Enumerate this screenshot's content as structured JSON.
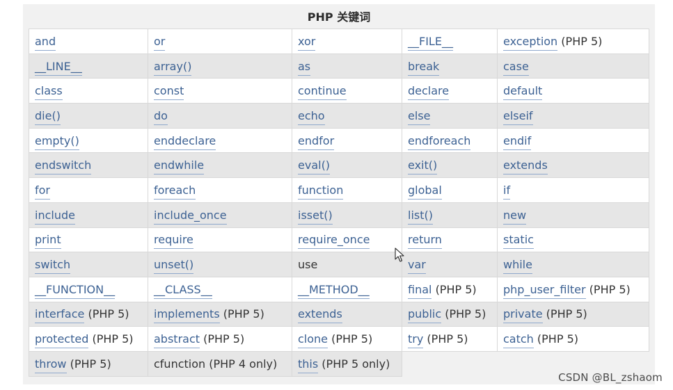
{
  "title": "PHP 关键词",
  "rows": [
    [
      {
        "text": "and",
        "link": true,
        "note": ""
      },
      {
        "text": "or",
        "link": true,
        "note": ""
      },
      {
        "text": "xor",
        "link": true,
        "note": ""
      },
      {
        "text": "__FILE__",
        "link": true,
        "note": ""
      },
      {
        "text": "exception",
        "link": true,
        "note": "(PHP 5)"
      }
    ],
    [
      {
        "text": "__LINE__",
        "link": true,
        "note": ""
      },
      {
        "text": "array()",
        "link": true,
        "note": ""
      },
      {
        "text": "as",
        "link": true,
        "note": ""
      },
      {
        "text": "break",
        "link": true,
        "note": ""
      },
      {
        "text": "case",
        "link": true,
        "note": ""
      }
    ],
    [
      {
        "text": "class",
        "link": true,
        "note": ""
      },
      {
        "text": "const",
        "link": true,
        "note": ""
      },
      {
        "text": "continue",
        "link": true,
        "note": ""
      },
      {
        "text": "declare",
        "link": true,
        "note": ""
      },
      {
        "text": "default",
        "link": true,
        "note": ""
      }
    ],
    [
      {
        "text": "die()",
        "link": true,
        "note": ""
      },
      {
        "text": "do",
        "link": true,
        "note": ""
      },
      {
        "text": "echo",
        "link": true,
        "note": ""
      },
      {
        "text": "else",
        "link": true,
        "note": ""
      },
      {
        "text": "elseif",
        "link": true,
        "note": ""
      }
    ],
    [
      {
        "text": "empty()",
        "link": true,
        "note": ""
      },
      {
        "text": "enddeclare",
        "link": true,
        "note": ""
      },
      {
        "text": "endfor",
        "link": true,
        "note": ""
      },
      {
        "text": "endforeach",
        "link": true,
        "note": ""
      },
      {
        "text": "endif",
        "link": true,
        "note": ""
      }
    ],
    [
      {
        "text": "endswitch",
        "link": true,
        "note": ""
      },
      {
        "text": "endwhile",
        "link": true,
        "note": ""
      },
      {
        "text": "eval()",
        "link": true,
        "note": ""
      },
      {
        "text": "exit()",
        "link": true,
        "note": ""
      },
      {
        "text": "extends",
        "link": true,
        "note": ""
      }
    ],
    [
      {
        "text": "for",
        "link": true,
        "note": ""
      },
      {
        "text": "foreach",
        "link": true,
        "note": ""
      },
      {
        "text": "function",
        "link": true,
        "note": ""
      },
      {
        "text": "global",
        "link": true,
        "note": ""
      },
      {
        "text": "if",
        "link": true,
        "note": ""
      }
    ],
    [
      {
        "text": "include",
        "link": true,
        "note": ""
      },
      {
        "text": "include_once",
        "link": true,
        "note": ""
      },
      {
        "text": "isset()",
        "link": true,
        "note": ""
      },
      {
        "text": "list()",
        "link": true,
        "note": ""
      },
      {
        "text": "new",
        "link": true,
        "note": ""
      }
    ],
    [
      {
        "text": "print",
        "link": true,
        "note": ""
      },
      {
        "text": "require",
        "link": true,
        "note": ""
      },
      {
        "text": "require_once",
        "link": true,
        "note": ""
      },
      {
        "text": "return",
        "link": true,
        "note": ""
      },
      {
        "text": "static",
        "link": true,
        "note": ""
      }
    ],
    [
      {
        "text": "switch",
        "link": true,
        "note": ""
      },
      {
        "text": "unset()",
        "link": true,
        "note": ""
      },
      {
        "text": "use",
        "link": false,
        "note": ""
      },
      {
        "text": "var",
        "link": true,
        "note": ""
      },
      {
        "text": "while",
        "link": true,
        "note": ""
      }
    ],
    [
      {
        "text": "__FUNCTION__",
        "link": true,
        "note": ""
      },
      {
        "text": "__CLASS__",
        "link": true,
        "note": ""
      },
      {
        "text": "__METHOD__",
        "link": true,
        "note": ""
      },
      {
        "text": "final",
        "link": true,
        "note": "(PHP 5)"
      },
      {
        "text": "php_user_filter",
        "link": true,
        "note": "(PHP 5)"
      }
    ],
    [
      {
        "text": "interface",
        "link": true,
        "note": "(PHP 5)"
      },
      {
        "text": "implements",
        "link": true,
        "note": "(PHP 5)"
      },
      {
        "text": "extends",
        "link": true,
        "note": ""
      },
      {
        "text": "public",
        "link": true,
        "note": "(PHP 5)"
      },
      {
        "text": "private",
        "link": true,
        "note": "(PHP 5)"
      }
    ],
    [
      {
        "text": "protected",
        "link": true,
        "note": "(PHP 5)"
      },
      {
        "text": "abstract",
        "link": true,
        "note": "(PHP 5)"
      },
      {
        "text": "clone",
        "link": true,
        "note": "(PHP 5)"
      },
      {
        "text": "try",
        "link": true,
        "note": "(PHP 5)"
      },
      {
        "text": "catch",
        "link": true,
        "note": "(PHP 5)"
      }
    ],
    [
      {
        "text": "throw",
        "link": true,
        "note": "(PHP 5)"
      },
      {
        "text": "cfunction",
        "link": false,
        "note": "(PHP 4 only)"
      },
      {
        "text": "this",
        "link": true,
        "note": "(PHP 5 only)"
      }
    ]
  ],
  "watermark": "CSDN @BL_zshaom",
  "colors": {
    "link": "#3c6193",
    "text": "#333333",
    "row_even": "#ffffff",
    "row_odd": "#e6e6e6"
  },
  "icons": {
    "cursor": "mouse-pointer-arrow-icon"
  }
}
